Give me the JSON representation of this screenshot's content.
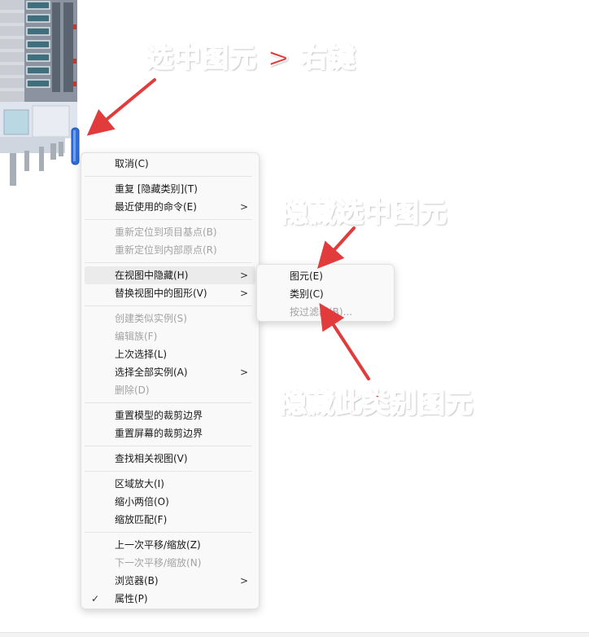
{
  "annotations": {
    "select_right_click": "选中图元 > 右键",
    "hide_selected": "隐藏选中图元",
    "hide_category": "隐藏此类别图元"
  },
  "context_menu": {
    "cancel": "取消(C)",
    "repeat": "重复 [隐藏类别](T)",
    "recent_commands": "最近使用的命令(E)",
    "relocate_base_point": "重新定位到项目基点(B)",
    "relocate_internal_origin": "重新定位到内部原点(R)",
    "hide_in_view": "在视图中隐藏(H)",
    "override_graphics": "替换视图中的图形(V)",
    "create_similar": "创建类似实例(S)",
    "edit_family": "编辑族(F)",
    "previous_selection": "上次选择(L)",
    "select_all_instances": "选择全部实例(A)",
    "delete": "删除(D)",
    "reset_model_crop": "重置模型的裁剪边界",
    "reset_screen_crop": "重置屏幕的裁剪边界",
    "find_referring_views": "查找相关视图(V)",
    "zoom_in_region": "区域放大(I)",
    "zoom_out_2x": "缩小两倍(O)",
    "zoom_to_fit": "缩放匹配(F)",
    "previous_pan_zoom": "上一次平移/缩放(Z)",
    "next_pan_zoom": "下一次平移/缩放(N)",
    "browsers": "浏览器(B)",
    "properties": "属性(P)",
    "submenu_arrow": ">",
    "check_mark": "✓"
  },
  "submenu": {
    "elements": "图元(E)",
    "category": "类别(C)",
    "by_filter": "按过滤器(B)..."
  },
  "colors": {
    "annotation": "#e23b3b",
    "menu_bg": "#f9f9f9",
    "highlight": "#ebebeb",
    "disabled_text": "#a3a3a3"
  }
}
